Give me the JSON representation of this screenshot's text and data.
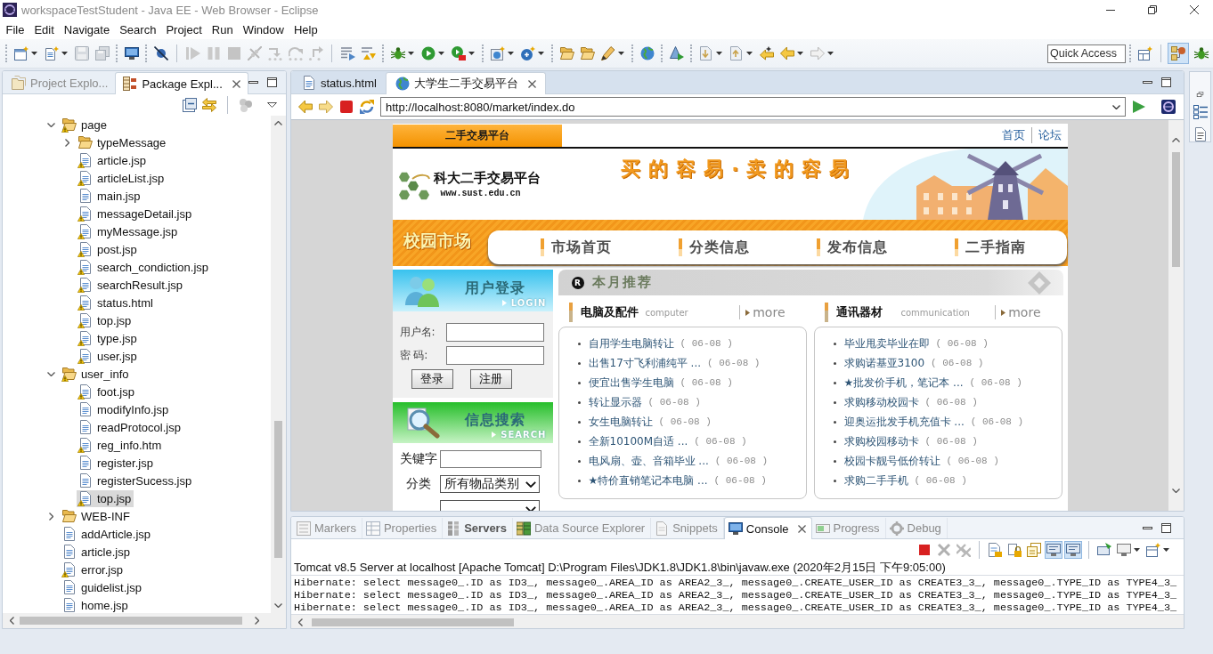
{
  "window": {
    "title": "workspaceTestStudent - Java EE - Web Browser - Eclipse"
  },
  "menu": [
    "File",
    "Edit",
    "Navigate",
    "Search",
    "Project",
    "Run",
    "Window",
    "Help"
  ],
  "quick_access": {
    "placeholder": "Quick Access"
  },
  "perspectives": [
    {
      "selected": true
    },
    {
      "selected": false
    }
  ],
  "explorer": {
    "tabs": [
      {
        "label": "Project Explo...",
        "selected": false
      },
      {
        "label": "Package Expl...",
        "selected": true
      }
    ],
    "tree": [
      {
        "label": "page",
        "kind": "folder",
        "expanded": true,
        "warning": true,
        "selected": false,
        "children": [
          {
            "label": "typeMessage",
            "kind": "folder",
            "expanded": false,
            "warning": false,
            "selected": false
          },
          {
            "label": "article.jsp",
            "kind": "file",
            "warning": true,
            "selected": false
          },
          {
            "label": "articleList.jsp",
            "kind": "file",
            "warning": true,
            "selected": false
          },
          {
            "label": "main.jsp",
            "kind": "file",
            "warning": false,
            "selected": false
          },
          {
            "label": "messageDetail.jsp",
            "kind": "file",
            "warning": true,
            "selected": false
          },
          {
            "label": "myMessage.jsp",
            "kind": "file",
            "warning": true,
            "selected": false
          },
          {
            "label": "post.jsp",
            "kind": "file",
            "warning": true,
            "selected": false
          },
          {
            "label": "search_condiction.jsp",
            "kind": "file",
            "warning": true,
            "selected": false
          },
          {
            "label": "searchResult.jsp",
            "kind": "file",
            "warning": true,
            "selected": false
          },
          {
            "label": "status.html",
            "kind": "file",
            "warning": true,
            "selected": false
          },
          {
            "label": "top.jsp",
            "kind": "file",
            "warning": true,
            "selected": false
          },
          {
            "label": "type.jsp",
            "kind": "file",
            "warning": true,
            "selected": false
          },
          {
            "label": "user.jsp",
            "kind": "file",
            "warning": true,
            "selected": false
          }
        ]
      },
      {
        "label": "user_info",
        "kind": "folder",
        "expanded": true,
        "warning": true,
        "selected": false,
        "children": [
          {
            "label": "foot.jsp",
            "kind": "file",
            "warning": true,
            "selected": false
          },
          {
            "label": "modifyInfo.jsp",
            "kind": "file",
            "warning": false,
            "selected": false
          },
          {
            "label": "readProtocol.jsp",
            "kind": "file",
            "warning": false,
            "selected": false
          },
          {
            "label": "reg_info.htm",
            "kind": "file",
            "warning": true,
            "selected": false
          },
          {
            "label": "register.jsp",
            "kind": "file",
            "warning": false,
            "selected": false
          },
          {
            "label": "registerSucess.jsp",
            "kind": "file",
            "warning": false,
            "selected": false
          },
          {
            "label": "top.jsp",
            "kind": "file",
            "warning": true,
            "selected": true
          }
        ]
      },
      {
        "label": "WEB-INF",
        "kind": "folder",
        "expanded": false,
        "warning": false,
        "selected": false
      },
      {
        "label": "addArticle.jsp",
        "kind": "file",
        "warning": false,
        "selected": false
      },
      {
        "label": "article.jsp",
        "kind": "file",
        "warning": false,
        "selected": false
      },
      {
        "label": "error.jsp",
        "kind": "file",
        "warning": true,
        "selected": false
      },
      {
        "label": "guidelist.jsp",
        "kind": "file",
        "warning": false,
        "selected": false
      },
      {
        "label": "home.jsp",
        "kind": "file",
        "warning": false,
        "selected": false
      }
    ]
  },
  "editor": {
    "tabs": [
      {
        "label": "status.html",
        "selected": false
      },
      {
        "label": "大学生二手交易平台",
        "selected": true
      }
    ],
    "url": "http://localhost:8080/market/index.do",
    "page": {
      "top_tab": "二手交易平台",
      "top_links": [
        "首页",
        "论坛"
      ],
      "site_name": "科大二手交易平台",
      "site_url": "www.sust.edu.cn",
      "slogan": "买的容易·卖的容易",
      "nav_label": "校园市场",
      "nav": [
        "市场首页",
        "分类信息",
        "发布信息",
        "二手指南"
      ],
      "login": {
        "title": "用户登录",
        "subtitle": "LOGIN",
        "fields": [
          {
            "label": "用户名:"
          },
          {
            "label": "密 码:"
          }
        ],
        "buttons": [
          "登录",
          "注册"
        ]
      },
      "search": {
        "title": "信息搜索",
        "subtitle": "SEARCH",
        "fields": [
          {
            "kind": "text",
            "label": "关键字"
          },
          {
            "kind": "select",
            "label": "分类",
            "value": "所有物品类别"
          },
          {
            "kind": "select"
          }
        ]
      },
      "featured": {
        "badge": "R",
        "title": "本月推荐",
        "columns": [
          {
            "title": "电脑及配件",
            "subtitle": "computer",
            "more": "more",
            "items": [
              {
                "title": "自用学生电脑转让",
                "date": "( 06-08 )"
              },
              {
                "title": "出售17寸飞利浦纯平 ...",
                "date": "( 06-08 )"
              },
              {
                "title": "便宜出售学生电脑",
                "date": "( 06-08 )"
              },
              {
                "title": "转让显示器",
                "date": "( 06-08 )"
              },
              {
                "title": "女生电脑转让",
                "date": "( 06-08 )"
              },
              {
                "title": "全新10100M自适 ...",
                "date": "( 06-08 )"
              },
              {
                "title": "电风扇、壶、音箱毕业 ...",
                "date": "( 06-08 )"
              },
              {
                "title": "★特价直销笔记本电脑 ...",
                "date": "( 06-08 )"
              }
            ]
          },
          {
            "title": "通讯器材",
            "subtitle": "communication",
            "more": "more",
            "items": [
              {
                "title": "毕业甩卖毕业在即",
                "date": "( 06-08 )"
              },
              {
                "title": "求购诺基亚3100",
                "date": "( 06-08 )"
              },
              {
                "title": "★批发价手机，笔记本 ...",
                "date": "( 06-08 )"
              },
              {
                "title": "求购移动校园卡",
                "date": "( 06-08 )"
              },
              {
                "title": "迎奥运批发手机充值卡 ...",
                "date": "( 06-08 )"
              },
              {
                "title": "求购校园移动卡",
                "date": "( 06-08 )"
              },
              {
                "title": "校园卡靓号低价转让",
                "date": "( 06-08 )"
              },
              {
                "title": "求购二手手机",
                "date": "( 06-08 )"
              }
            ]
          }
        ]
      }
    }
  },
  "console": {
    "tabs": [
      {
        "label": "Markers",
        "selected": false,
        "changed": false
      },
      {
        "label": "Properties",
        "selected": false,
        "changed": false
      },
      {
        "label": "Servers",
        "selected": false,
        "changed": true
      },
      {
        "label": "Data Source Explorer",
        "selected": false,
        "changed": false
      },
      {
        "label": "Snippets",
        "selected": false,
        "changed": false
      },
      {
        "label": "Console",
        "selected": true,
        "changed": false
      },
      {
        "label": "Progress",
        "selected": false,
        "changed": false
      },
      {
        "label": "Debug",
        "selected": false,
        "changed": false
      }
    ],
    "toggles": [
      {
        "on": true
      },
      {
        "on": true
      }
    ],
    "description": "Tomcat v8.5 Server at localhost [Apache Tomcat] D:\\Program Files\\JDK1.8\\JDK1.8\\bin\\javaw.exe (2020年2月15日 下午9:05:00)",
    "lines": [
      "Hibernate: select message0_.ID as ID3_, message0_.AREA_ID as AREA2_3_, message0_.CREATE_USER_ID as CREATE3_3_, message0_.TYPE_ID as TYPE4_3_",
      "Hibernate: select message0_.ID as ID3_, message0_.AREA_ID as AREA2_3_, message0_.CREATE_USER_ID as CREATE3_3_, message0_.TYPE_ID as TYPE4_3_",
      "Hibernate: select message0_.ID as ID3_, message0_.AREA_ID as AREA2_3_, message0_.CREATE_USER_ID as CREATE3_3_, message0_.TYPE_ID as TYPE4_3_"
    ]
  }
}
